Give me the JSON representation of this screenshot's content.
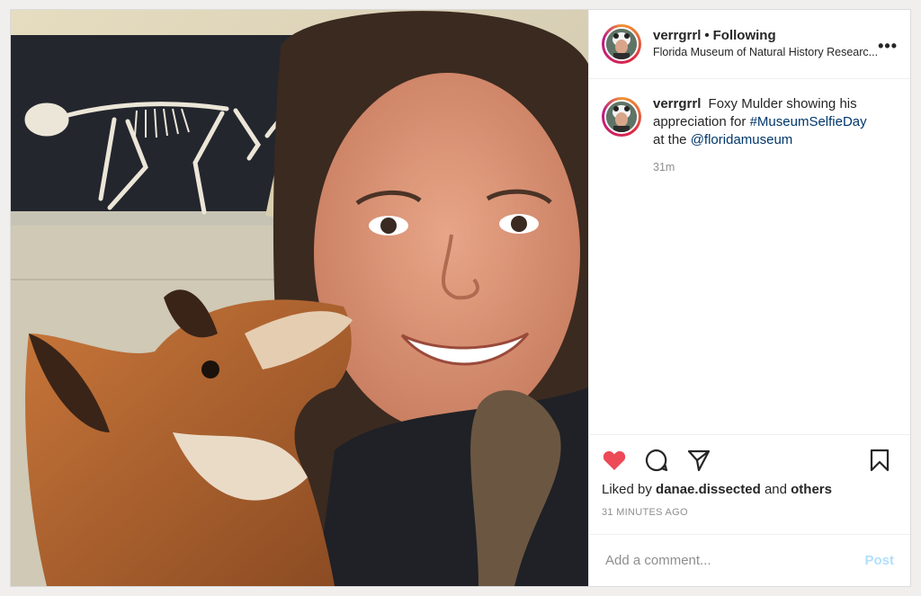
{
  "post": {
    "username": "verrgrrl",
    "separator": "•",
    "following": "Following",
    "location": "Florida Museum of Natural History Researc...",
    "more": "•••"
  },
  "caption": {
    "username": "verrgrrl",
    "text_1": "Foxy Mulder showing his appreciation for",
    "hashtag": "#MuseumSelfieDay",
    "text_2": "at the",
    "mention": "@floridamuseum",
    "time": "31m"
  },
  "likes": {
    "prefix": "Liked by",
    "user": "danae.dissected",
    "and": "and",
    "others": "others",
    "time_ago": "31 MINUTES AGO"
  },
  "comment": {
    "placeholder": "Add a comment...",
    "post_label": "Post"
  },
  "icons": {
    "like": "heart-filled-icon",
    "comment": "comment-icon",
    "share": "paper-plane-icon",
    "save": "bookmark-icon",
    "more": "more-options-icon"
  },
  "colors": {
    "heart": "#ed4956",
    "link": "#00376b",
    "post_disabled": "#b2dffc",
    "muted": "#8e8e8e"
  }
}
